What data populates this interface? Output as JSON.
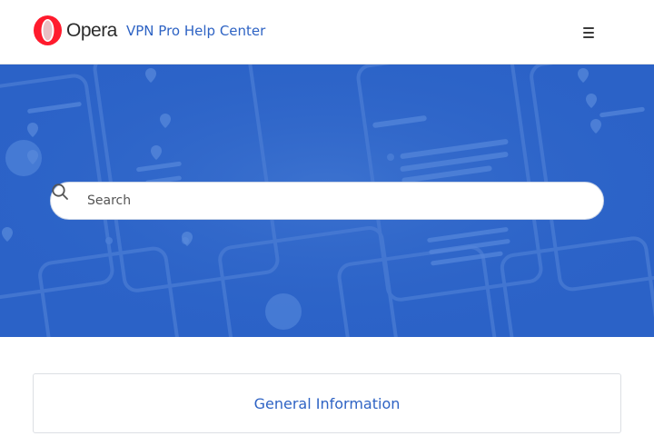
{
  "header": {
    "logo_text": "Opera",
    "site_title": "VPN Pro Help Center",
    "menu_icon": "hamburger-menu-icon"
  },
  "hero": {
    "background_color": "#2c64c9",
    "search": {
      "placeholder": "Search",
      "value": "",
      "icon": "search-icon"
    }
  },
  "categories": [
    {
      "title": "General Information"
    }
  ],
  "colors": {
    "brand_red": "#ff1b2d",
    "link_blue": "#2e63c4"
  }
}
